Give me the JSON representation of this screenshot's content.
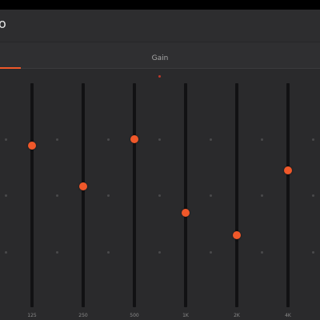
{
  "colors": {
    "accent": "#f0582a",
    "center_dot": "#c0392b"
  },
  "app": {
    "title": "o"
  },
  "tabs": {
    "active_label": "Gain"
  },
  "bands": [
    {
      "label": "125",
      "level": 0.72
    },
    {
      "label": "250",
      "level": 0.54
    },
    {
      "label": "500",
      "level": 0.75
    },
    {
      "label": "1K",
      "level": 0.42
    },
    {
      "label": "2K",
      "level": 0.32
    },
    {
      "label": "4K",
      "level": 0.61
    }
  ]
}
